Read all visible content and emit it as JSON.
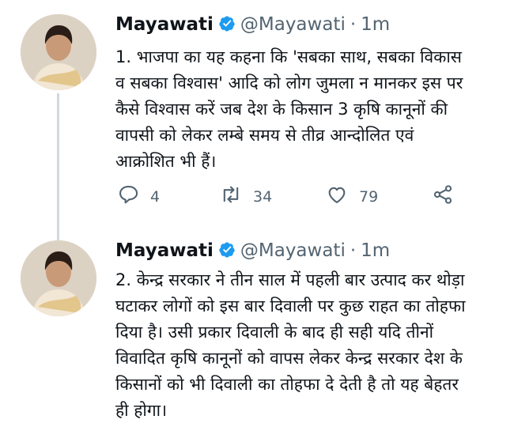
{
  "tweets": [
    {
      "author_name": "Mayawati",
      "handle": "@Mayawati",
      "separator": "·",
      "time": "1m",
      "lines": [
        "1. भाजपा का यह कहना कि 'सबका साथ, सबका विकास",
        "व सबका विश्वास' आदि को लोग जुमला न मानकर इस पर",
        "कैसे विश्वास करें जब देश के किसान 3 कृषि कानूनों की",
        "वापसी को लेकर लम्बे समय से तीव्र आन्दोलित एवं",
        "आक्रोशित भी हैं।"
      ],
      "reply_count": "4",
      "retweet_count": "34",
      "like_count": "79"
    },
    {
      "author_name": "Mayawati",
      "handle": "@Mayawati",
      "separator": "·",
      "time": "1m",
      "lines": [
        "2. केन्द्र सरकार ने तीन साल में पहली बार उत्पाद कर थोड़ा",
        "घटाकर लोगों को इस बार दिवाली पर कुछ राहत का तोहफा",
        "दिया है। उसी प्रकार दिवाली के बाद ही सही यदि तीनों",
        "विवादित कृषि कानूनों को वापस लेकर केन्द्र सरकार देश के",
        "किसानों को भी दिवाली का तोहफा दे देती है तो यह बेहतर",
        "ही होगा।"
      ]
    }
  ],
  "colors": {
    "verified": "#1d9bf0",
    "secondary_text": "#536471",
    "thread_line": "#cfd9de"
  },
  "icons": [
    "verified-badge-icon",
    "reply-icon",
    "retweet-icon",
    "like-icon",
    "share-icon"
  ]
}
